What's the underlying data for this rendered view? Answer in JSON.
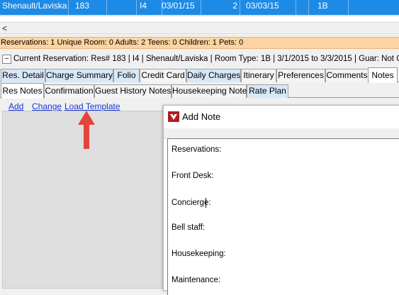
{
  "grid_row": {
    "cells": [
      "Shenault/Laviska",
      "183",
      "",
      "I4",
      "03/01/15",
      "2",
      "03/03/15",
      "",
      "1B",
      ""
    ]
  },
  "scrollbar": {
    "left_arrow": "<"
  },
  "summary_bar": {
    "text": "Reservations: 1   Unique Room: 0   Adults: 2   Teens: 0   Children: 1   Pets: 0"
  },
  "current_reservation": {
    "collapse_symbol": "–",
    "text": "Current Reservation: Res# 183  | I4  | Shenault/Laviska  | Room Type: 1B  | 3/1/2015 to 3/3/2015  | Guar: Not Guaranteed"
  },
  "tabs_row1": [
    {
      "label": "Res. Detail",
      "style": "blue"
    },
    {
      "label": "Charge Summary",
      "style": "blue"
    },
    {
      "label": "Folio",
      "style": "blue"
    },
    {
      "label": "Credit Card",
      "style": "plain"
    },
    {
      "label": "Daily Charges",
      "style": "blue"
    },
    {
      "label": "Itinerary",
      "style": "plain"
    },
    {
      "label": "Preferences",
      "style": "plain"
    },
    {
      "label": "Comments",
      "style": "plain"
    },
    {
      "label": "Notes",
      "style": "active"
    }
  ],
  "tabs_row2": [
    {
      "label": "Res Notes",
      "style": "active"
    },
    {
      "label": "Confirmation",
      "style": "plain"
    },
    {
      "label": "Guest History Notes",
      "style": "plain"
    },
    {
      "label": "Housekeeping Notes",
      "style": "plain"
    },
    {
      "label": "Rate Plan",
      "style": "blue"
    }
  ],
  "actions": {
    "add": "Add",
    "change": "Change",
    "load_template": "Load Template"
  },
  "dialog": {
    "title": "Add Note",
    "note_lines": [
      "Reservations:",
      "Front Desk:",
      "Concierge:",
      "Bell staff:",
      "Housekeeping:",
      "Maintenance:"
    ]
  },
  "colors": {
    "selected_row": "#1d8ae6",
    "summary_bar": "#fbd4a2",
    "link": "#1a36d4",
    "arrow": "#e2463b",
    "blue_tab": "#d8e8f8"
  }
}
